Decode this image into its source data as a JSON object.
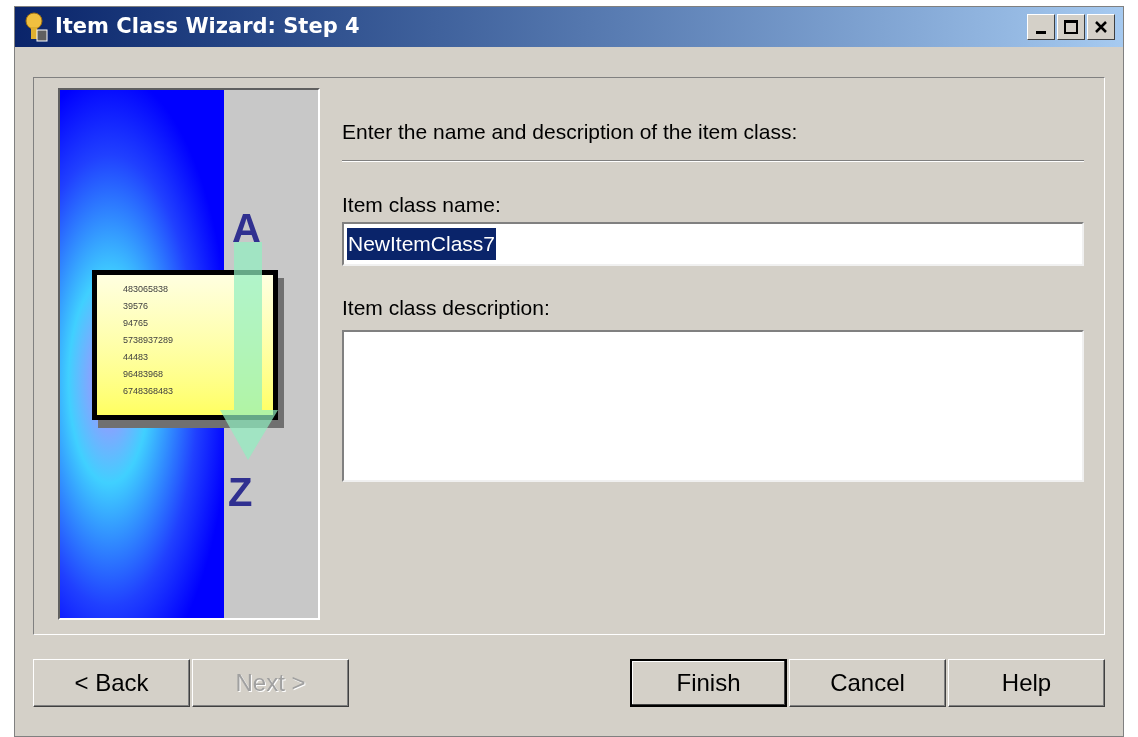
{
  "window": {
    "title": "Item Class Wizard: Step 4"
  },
  "illustration": {
    "top_letter": "A",
    "bottom_letter": "Z",
    "numbers": [
      "483065838",
      "39576",
      "94765",
      "5738937289",
      "44483",
      "96483968",
      "6748368483"
    ]
  },
  "instruction": "Enter the name and description of the item class:",
  "name_field": {
    "label": "Item class name:",
    "value": "NewItemClass7",
    "selected": true
  },
  "description_field": {
    "label": "Item class description:"
  },
  "nav_buttons": [
    {
      "label": "< Back",
      "disabled": false,
      "default": false
    },
    {
      "label": "Next >",
      "disabled": true,
      "default": false
    }
  ],
  "action_buttons": [
    {
      "label": "Finish",
      "disabled": false,
      "default": true
    },
    {
      "label": "Cancel",
      "disabled": false,
      "default": false
    },
    {
      "label": "Help",
      "disabled": false,
      "default": false
    }
  ]
}
